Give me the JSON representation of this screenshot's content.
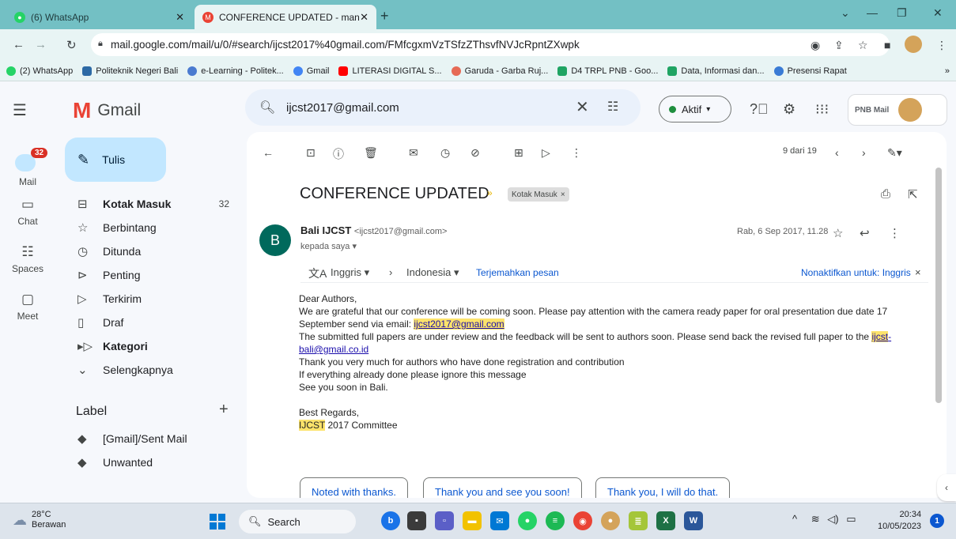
{
  "browser": {
    "tabs": [
      {
        "title": "(6) WhatsApp",
        "active": false
      },
      {
        "title": "CONFERENCE UPDATED - manik",
        "active": true
      }
    ],
    "url": "mail.google.com/mail/u/0/#search/ijcst2017%40gmail.com/FMfcgxmVzTSfzZThsvfNVJcRpntZXwpk",
    "bookmarks": [
      "(2) WhatsApp",
      "Politeknik Negeri Bali",
      "e-Learning - Politek...",
      "Gmail",
      "LITERASI DIGITAL S...",
      "Garuda - Garba Ruj...",
      "D4 TRPL PNB - Goo...",
      "Data, Informasi dan...",
      "Presensi Rapat"
    ]
  },
  "gmail": {
    "logo_text": "Gmail",
    "search": {
      "value": "ijcst2017@gmail.com"
    },
    "status": "Aktif",
    "account_logo": "PNB Mail",
    "rail": {
      "mail_badge": "32",
      "items": [
        "Mail",
        "Chat",
        "Spaces",
        "Meet"
      ]
    },
    "compose_label": "Tulis",
    "nav": [
      {
        "label": "Kotak Masuk",
        "count": "32",
        "bold": true
      },
      {
        "label": "Berbintang",
        "count": ""
      },
      {
        "label": "Ditunda",
        "count": ""
      },
      {
        "label": "Penting",
        "count": ""
      },
      {
        "label": "Terkirim",
        "count": ""
      },
      {
        "label": "Draf",
        "count": ""
      },
      {
        "label": "Kategori",
        "count": "",
        "bold": true
      },
      {
        "label": "Selengkapnya",
        "count": ""
      }
    ],
    "labels_heading": "Label",
    "labels": [
      "[Gmail]/Sent Mail",
      "Unwanted"
    ],
    "page_count": "9 dari 19",
    "email": {
      "subject": "CONFERENCE UPDATED",
      "label_chip": "Kotak Masuk",
      "sender_initial": "B",
      "sender_name": "Bali IJCST",
      "sender_email": "<ijcst2017@gmail.com>",
      "to": "kepada saya",
      "date": "Rab, 6 Sep 2017, 11.28",
      "translate": {
        "from": "Inggris",
        "to": "Indonesia",
        "action": "Terjemahkan pesan",
        "disable": "Nonaktifkan untuk: Inggris"
      },
      "body": {
        "greeting": "Dear Authors,",
        "line1a": "We are grateful that our conference will be coming soon. Please pay attention with the camera ready paper for oral presentation due date 17 September send via email: ",
        "line1_email": "ijcst2017@gmail.com",
        "line2a": "The submitted full papers are under review and the feedback will be  sent to authors soon. Please send back the revised full paper to the ",
        "line2_hl": "ijcst",
        "line2_email": "-bali@gmail.co.id",
        "line3": "Thank you very much for authors who have done registration and contribution",
        "line4": "If everything already done please ignore this message",
        "line5": "See you soon in Bali.",
        "regards": "Best Regards,",
        "signature_hl": "IJCST",
        "signature_rest": " 2017 Committee"
      },
      "smart_replies": [
        "Noted with thanks.",
        "Thank you and see you soon!",
        "Thank you, I will do that."
      ]
    }
  },
  "taskbar": {
    "weather_temp": "28°C",
    "weather_desc": "Berawan",
    "search_label": "Search",
    "time": "20:34",
    "date": "10/05/2023",
    "notifications": "1"
  }
}
